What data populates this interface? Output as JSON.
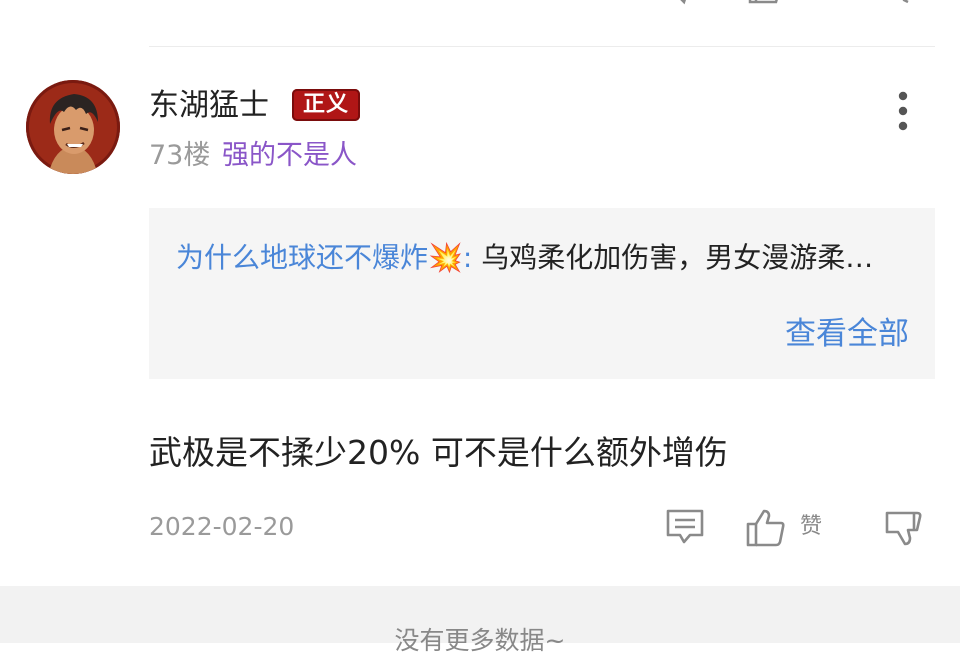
{
  "comment": {
    "username": "东湖猛士",
    "badge": "正义",
    "floor": "73楼",
    "user_title": "强的不是人",
    "quote": {
      "author": "为什么地球还不爆炸💥:",
      "text": " 乌鸡柔化加伤害，男女漫游柔…",
      "view_all": "查看全部"
    },
    "content": "武极是不揉少20% 可不是什么额外增伤",
    "date": "2022-02-20",
    "actions": {
      "reply_icon": "comment-icon",
      "like_icon": "thumbs-up-icon",
      "like_label": "赞",
      "dislike_icon": "thumbs-down-icon",
      "more_icon": "more-vertical-icon"
    }
  },
  "footer": {
    "no_more_text": "没有更多数据~"
  },
  "colors": {
    "link_blue": "#4a86d8",
    "title_purple": "#8a56c8",
    "badge_red": "#b01616",
    "muted_gray": "#9a9a9a"
  }
}
